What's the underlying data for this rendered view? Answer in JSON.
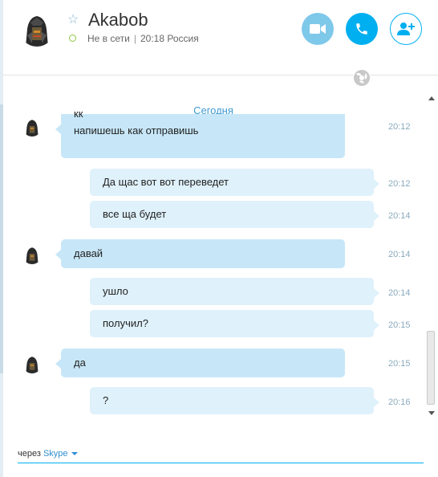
{
  "contact": {
    "name": "Akabob",
    "status": "Не в сети",
    "local_time": "20:18 Россия",
    "status_color": "#8dc63f"
  },
  "header_actions": [
    {
      "icon": "video-call-icon"
    },
    {
      "icon": "phone-call-icon"
    },
    {
      "icon": "add-contact-icon"
    }
  ],
  "chat": {
    "date_separator": "Сегодня",
    "messages": [
      {
        "direction": "in",
        "text": "кк",
        "time": "20:12",
        "show_avatar": true
      },
      {
        "direction": "in",
        "text": "напишешь как отправишь",
        "time": ""
      },
      {
        "direction": "out",
        "text": "Да щас вот вот переведет",
        "time": "20:12"
      },
      {
        "direction": "out",
        "text": "все ща будет",
        "time": "20:14"
      },
      {
        "direction": "in",
        "text": "давай",
        "time": "20:14",
        "show_avatar": true
      },
      {
        "direction": "out",
        "text": "ушло",
        "time": "20:14"
      },
      {
        "direction": "out",
        "text": "получил?",
        "time": "20:15"
      },
      {
        "direction": "in",
        "text": "да",
        "time": "20:15",
        "show_avatar": true
      },
      {
        "direction": "out",
        "text": "?",
        "time": "20:16"
      }
    ]
  },
  "footer": {
    "prefix": "через",
    "service": "Skype"
  },
  "colors": {
    "accent": "#00aff0",
    "incoming_bubble": "#c7e7f8",
    "outgoing_bubble": "#dff1fb",
    "date_text": "#3f9ad3"
  }
}
